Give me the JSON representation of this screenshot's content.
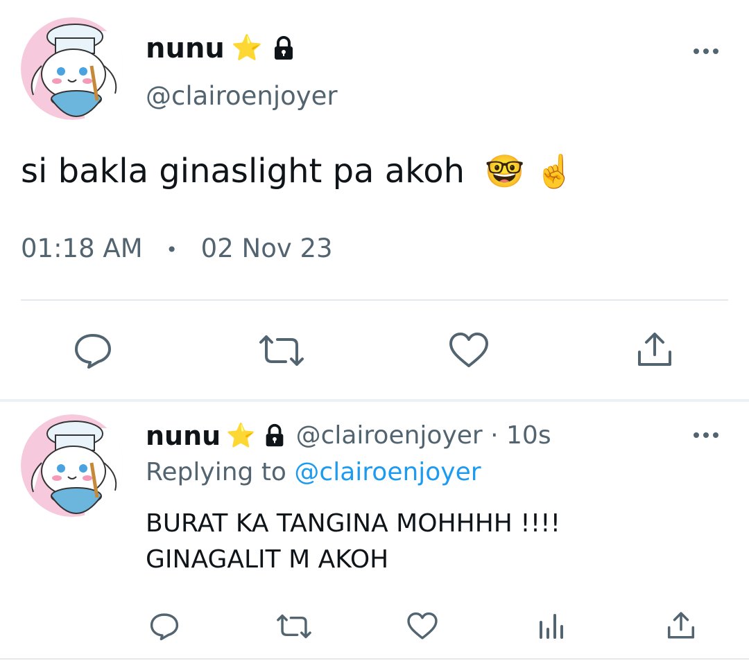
{
  "main_tweet": {
    "author_name": "nunu",
    "star_emoji": "⭐",
    "handle": "@clairoenjoyer",
    "text": "si bakla ginaslight pa akoh",
    "emojis": "🤓 ☝️",
    "time": "01:18 AM",
    "separator": "•",
    "date": "02 Nov 23"
  },
  "reply_tweet": {
    "author_name": "nunu",
    "star_emoji": "⭐",
    "handle_time": "@clairoenjoyer · 10s",
    "replying_prefix": "Replying to",
    "replying_handle": "@clairoenjoyer",
    "text_line1": "BURAT KA TANGINA MOHHHH !!!!",
    "text_line2": "GINAGALIT M AKOH"
  },
  "icons": {
    "more": "more-horizontal-icon",
    "reply": "reply-bubble-icon",
    "retweet": "retweet-icon",
    "like": "heart-icon",
    "share": "share-icon",
    "analytics": "analytics-bars-icon",
    "lock": "lock-icon"
  },
  "colors": {
    "icon_gray": "#536471",
    "link_blue": "#1d9bf0",
    "avatar_pink": "#f6c9dc"
  }
}
